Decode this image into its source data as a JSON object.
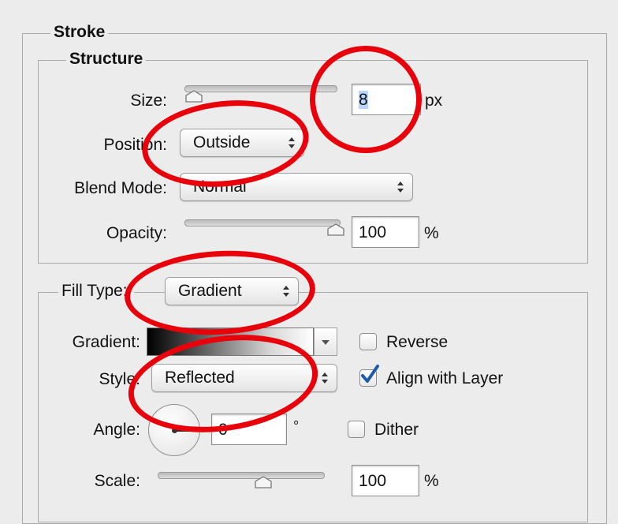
{
  "stroke": {
    "title": "Stroke",
    "structure": {
      "title": "Structure",
      "size_label": "Size:",
      "size_value": "8",
      "size_unit": "px",
      "position_label": "Position:",
      "position_value": "Outside",
      "blend_mode_label": "Blend Mode:",
      "blend_mode_value": "Normal",
      "opacity_label": "Opacity:",
      "opacity_value": "100",
      "opacity_unit": "%"
    },
    "fill": {
      "fill_type_label": "Fill Type:",
      "fill_type_value": "Gradient",
      "gradient_label": "Gradient:",
      "reverse_label": "Reverse",
      "reverse_checked": false,
      "style_label": "Style:",
      "style_value": "Reflected",
      "align_label": "Align with Layer",
      "align_checked": true,
      "angle_label": "Angle:",
      "angle_value": "0",
      "angle_unit": "°",
      "dither_label": "Dither",
      "dither_checked": false,
      "scale_label": "Scale:",
      "scale_value": "100",
      "scale_unit": "%"
    }
  },
  "colors": {
    "highlight_ring": "#e8000a",
    "checkmark": "#1f5aa8"
  }
}
